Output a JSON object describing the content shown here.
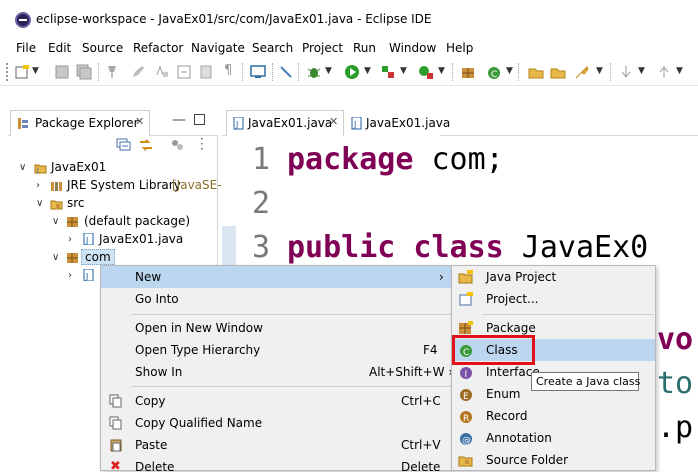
{
  "window": {
    "title": "eclipse-workspace - JavaEx01/src/com/JavaEx01.java - Eclipse IDE"
  },
  "menu": [
    "File",
    "Edit",
    "Source",
    "Refactor",
    "Navigate",
    "Search",
    "Project",
    "Run",
    "Window",
    "Help"
  ],
  "package_explorer": {
    "tab_label": "Package Explorer",
    "tree": [
      {
        "label": "JavaEx01",
        "extra": ""
      },
      {
        "label": "JRE System Library",
        "extra": "[JavaSE-"
      },
      {
        "label": "src",
        "extra": ""
      },
      {
        "label": "(default package)",
        "extra": ""
      },
      {
        "label": "JavaEx01.java",
        "extra": ""
      },
      {
        "label": "com",
        "extra": ""
      }
    ]
  },
  "editor": {
    "tabs": [
      "JavaEx01.java",
      "JavaEx01.java"
    ],
    "lines": [
      {
        "num": "1",
        "kw": "package",
        "rest": " com;"
      },
      {
        "num": "2",
        "kw": "",
        "rest": ""
      },
      {
        "num": "3",
        "kw": "public class",
        "rest": " JavaEx0"
      }
    ],
    "peek": [
      "vo",
      "to",
      ".pr"
    ]
  },
  "context_menu": {
    "items": [
      {
        "label": "New",
        "accel": "›"
      },
      {
        "label": "Go Into",
        "accel": ""
      },
      {
        "label": "Open in New Window",
        "accel": ""
      },
      {
        "label": "Open Type Hierarchy",
        "accel": "F4"
      },
      {
        "label": "Show In",
        "accel": "Alt+Shift+W ›"
      },
      {
        "label": "Copy",
        "accel": "Ctrl+C"
      },
      {
        "label": "Copy Qualified Name",
        "accel": ""
      },
      {
        "label": "Paste",
        "accel": "Ctrl+V"
      },
      {
        "label": "Delete",
        "accel": "Delete"
      }
    ]
  },
  "submenu": {
    "items": [
      "Java Project",
      "Project...",
      "Package",
      "Class",
      "Interface",
      "Enum",
      "Record",
      "Annotation",
      "Source Folder"
    ]
  },
  "tooltip": "Create a Java class",
  "colors": {
    "keyword": "#7f0055",
    "highlight": "#bcd6f0",
    "annotation_box": "#e0101a"
  }
}
